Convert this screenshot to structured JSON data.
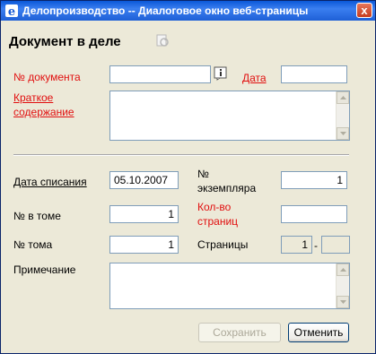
{
  "window": {
    "title": "Делопроизводство -- Диалоговое окно веб-страницы",
    "close_label": "x"
  },
  "header": {
    "title": "Документ в деле"
  },
  "fields": {
    "doc_number_label": "№ документа",
    "doc_number_value": "",
    "date_label": "Дата",
    "date_value": "",
    "summary_label": "Краткое содержание",
    "writeoff_date_label": "Дата списания",
    "writeoff_date_value": "05.10.2007",
    "copy_number_label": "№ экземпляра",
    "copy_number_value": "1",
    "volume_index_label": "№ в томе",
    "volume_index_value": "1",
    "page_count_label": "Кол-во страниц",
    "page_count_value": "",
    "volume_number_label": "№ тома",
    "volume_number_value": "1",
    "pages_label": "Страницы",
    "pages_from": "1",
    "pages_dash": "-",
    "pages_to": "",
    "note_label": "Примечание"
  },
  "buttons": {
    "save": "Сохранить",
    "cancel": "Отменить"
  },
  "colors": {
    "required_label": "#e10f0f",
    "title_bar": "#0a58d8"
  }
}
